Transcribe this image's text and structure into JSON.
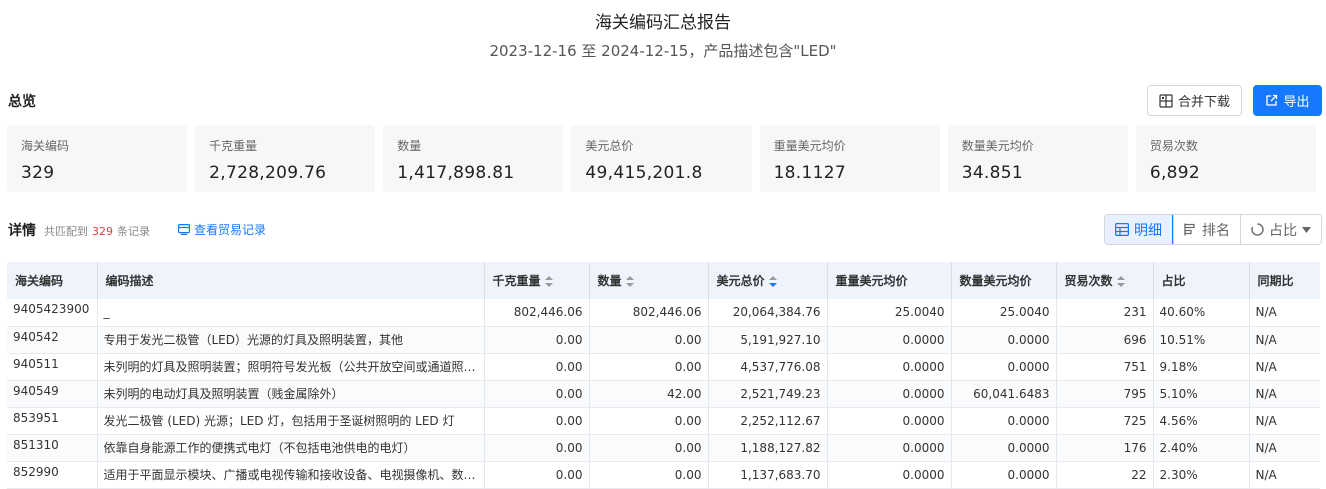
{
  "header": {
    "title": "海关编码汇总报告",
    "subtitle": "2023-12-16 至 2024-12-15，产品描述包含\"LED\""
  },
  "overview": {
    "title": "总览",
    "merge_download_label": "合并下载",
    "export_label": "导出",
    "cards": [
      {
        "label": "海关编码",
        "value": "329"
      },
      {
        "label": "千克重量",
        "value": "2,728,209.76"
      },
      {
        "label": "数量",
        "value": "1,417,898.81"
      },
      {
        "label": "美元总价",
        "value": "49,415,201.8"
      },
      {
        "label": "重量美元均价",
        "value": "18.1127"
      },
      {
        "label": "数量美元均价",
        "value": "34.851"
      },
      {
        "label": "贸易次数",
        "value": "6,892"
      }
    ]
  },
  "details": {
    "title": "详情",
    "match_prefix": "共匹配到",
    "match_count": "329",
    "match_suffix": "条记录",
    "view_records_label": "查看贸易记录",
    "view_toggle": {
      "detail_label": "明细",
      "rank_label": "排名",
      "share_label": "占比"
    }
  },
  "colors": {
    "accent": "#1677ff",
    "highlight_count": "#e03e3e",
    "header_bg": "#eef3fc",
    "card_bg": "#f6f7f9"
  },
  "table": {
    "columns": [
      "海关编码",
      "编码描述",
      "千克重量",
      "数量",
      "美元总价",
      "重量美元均价",
      "数量美元均价",
      "贸易次数",
      "占比",
      "同期比"
    ],
    "rows": [
      [
        "9405423900",
        "_",
        "802,446.06",
        "802,446.06",
        "20,064,384.76",
        "25.0040",
        "25.0040",
        "231",
        "40.60%",
        "N/A"
      ],
      [
        "940542",
        "专用于发光二极管（LED）光源的灯具及照明装置，其他",
        "0.00",
        "0.00",
        "5,191,927.10",
        "0.0000",
        "0.0000",
        "696",
        "10.51%",
        "N/A"
      ],
      [
        "940511",
        "未列明的灯具及照明装置；照明符号发光板（公共开放空间或通道照明用…",
        "0.00",
        "0.00",
        "4,537,776.08",
        "0.0000",
        "0.0000",
        "751",
        "9.18%",
        "N/A"
      ],
      [
        "940549",
        "未列明的电动灯具及照明装置（贱金属除外）",
        "0.00",
        "42.00",
        "2,521,749.23",
        "0.0000",
        "60,041.6483",
        "795",
        "5.10%",
        "N/A"
      ],
      [
        "853951",
        "发光二极管 (LED) 光源；LED 灯，包括用于圣诞树照明的 LED 灯",
        "0.00",
        "0.00",
        "2,252,112.67",
        "0.0000",
        "0.0000",
        "725",
        "4.56%",
        "N/A"
      ],
      [
        "851310",
        "依靠自身能源工作的便携式电灯（不包括电池供电的电灯）",
        "0.00",
        "0.00",
        "1,188,127.82",
        "0.0000",
        "0.0000",
        "176",
        "2.40%",
        "N/A"
      ],
      [
        "852990",
        "适用于平面显示模块、广播或电视传输和接收设备、电视摄像机、数码相…",
        "0.00",
        "0.00",
        "1,137,683.70",
        "0.0000",
        "0.0000",
        "22",
        "2.30%",
        "N/A"
      ]
    ]
  }
}
